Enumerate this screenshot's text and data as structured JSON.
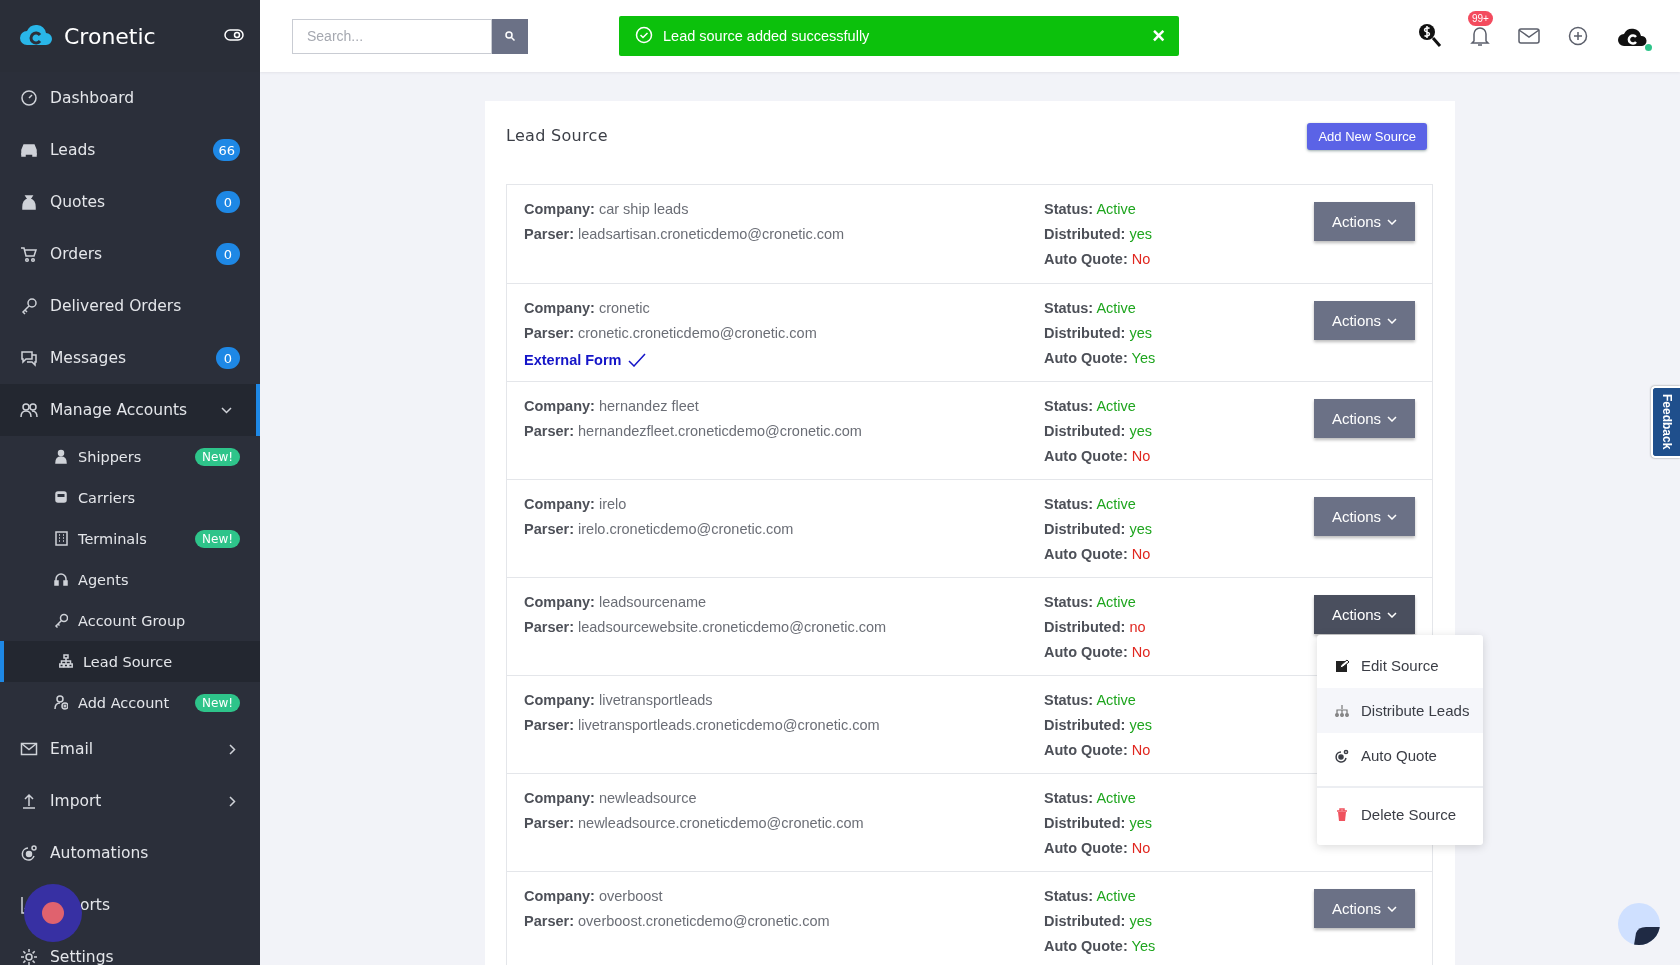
{
  "brand": {
    "name": "Cronetic"
  },
  "sidebar": {
    "items": [
      {
        "kind": "item",
        "label": "Dashboard",
        "selected": false
      },
      {
        "kind": "item",
        "label": "Leads",
        "badge": {
          "text": "66",
          "kind": "count"
        },
        "selected": false
      },
      {
        "kind": "item",
        "label": "Quotes",
        "badge": {
          "text": "0",
          "kind": "count"
        },
        "selected": false
      },
      {
        "kind": "item",
        "label": "Orders",
        "badge": {
          "text": "0",
          "kind": "count"
        },
        "selected": false
      },
      {
        "kind": "item",
        "label": "Delivered Orders",
        "selected": false
      },
      {
        "kind": "item",
        "label": "Messages",
        "badge": {
          "text": "0",
          "kind": "count"
        },
        "selected": false
      },
      {
        "kind": "group",
        "label": "Manage Accounts",
        "expanded": true,
        "selected": false,
        "children": [
          {
            "label": "Shippers",
            "badge": {
              "text": "New!",
              "kind": "new"
            },
            "selected": false
          },
          {
            "label": "Carriers",
            "selected": false
          },
          {
            "label": "Terminals",
            "badge": {
              "text": "New!",
              "kind": "new"
            },
            "selected": false
          },
          {
            "label": "Agents",
            "selected": false
          },
          {
            "label": "Account Group",
            "selected": false
          },
          {
            "label": "Lead Source",
            "selected": true
          },
          {
            "label": "Add Account",
            "badge": {
              "text": "New!",
              "kind": "new"
            },
            "selected": false
          }
        ]
      },
      {
        "kind": "group",
        "label": "Email",
        "expanded": false,
        "selected": false
      },
      {
        "kind": "group",
        "label": "Import",
        "expanded": false,
        "selected": false
      },
      {
        "kind": "item",
        "label": "Automations",
        "selected": false
      },
      {
        "kind": "item",
        "label": "orts",
        "obscured": true,
        "selected": false
      },
      {
        "kind": "item",
        "label": "Settings",
        "selected": false
      }
    ]
  },
  "topbar": {
    "search": {
      "placeholder": "Search..."
    },
    "toast": {
      "message": "Lead source added successfully",
      "close": "×"
    },
    "notifications_badge": "99+"
  },
  "card": {
    "title": "Lead Source",
    "add_button": "Add New Source",
    "rows": [
      {
        "left": [
          {
            "label": "Company:",
            "value": "car ship leads"
          },
          {
            "label": "Parser:",
            "value": "leadsartisan.croneticdemo@cronetic.com"
          }
        ],
        "right": [
          {
            "label": "Status:",
            "value": "Active",
            "positive": true
          },
          {
            "label": "Distributed:",
            "value": "yes",
            "positive": true
          },
          {
            "label": "Auto Quote:",
            "value": "No",
            "positive": false
          }
        ],
        "actions": {
          "label": "Actions",
          "open": false
        }
      },
      {
        "left": [
          {
            "label": "Company:",
            "value": "cronetic"
          },
          {
            "label": "Parser:",
            "value": "cronetic.croneticdemo@cronetic.com"
          }
        ],
        "external_form": "External Form",
        "right": [
          {
            "label": "Status:",
            "value": "Active",
            "positive": true
          },
          {
            "label": "Distributed:",
            "value": "yes",
            "positive": true
          },
          {
            "label": "Auto Quote:",
            "value": "Yes",
            "positive": true
          }
        ],
        "actions": {
          "label": "Actions",
          "open": false
        }
      },
      {
        "left": [
          {
            "label": "Company:",
            "value": "hernandez fleet"
          },
          {
            "label": "Parser:",
            "value": "hernandezfleet.croneticdemo@cronetic.com"
          }
        ],
        "right": [
          {
            "label": "Status:",
            "value": "Active",
            "positive": true
          },
          {
            "label": "Distributed:",
            "value": "yes",
            "positive": true
          },
          {
            "label": "Auto Quote:",
            "value": "No",
            "positive": false
          }
        ],
        "actions": {
          "label": "Actions",
          "open": false
        }
      },
      {
        "left": [
          {
            "label": "Company:",
            "value": "irelo"
          },
          {
            "label": "Parser:",
            "value": "irelo.croneticdemo@cronetic.com"
          }
        ],
        "right": [
          {
            "label": "Status:",
            "value": "Active",
            "positive": true
          },
          {
            "label": "Distributed:",
            "value": "yes",
            "positive": true
          },
          {
            "label": "Auto Quote:",
            "value": "No",
            "positive": false
          }
        ],
        "actions": {
          "label": "Actions",
          "open": false
        }
      },
      {
        "left": [
          {
            "label": "Company:",
            "value": "leadsourcename"
          },
          {
            "label": "Parser:",
            "value": "leadsourcewebsite.croneticdemo@cronetic.com"
          }
        ],
        "right": [
          {
            "label": "Status:",
            "value": "Active",
            "positive": true
          },
          {
            "label": "Distributed:",
            "value": "no",
            "positive": false
          },
          {
            "label": "Auto Quote:",
            "value": "No",
            "positive": false
          }
        ],
        "actions": {
          "label": "Actions",
          "open": true,
          "menu": [
            {
              "kind": "edit",
              "label": "Edit Source",
              "selected": false
            },
            {
              "kind": "distribute",
              "label": "Distribute Leads",
              "selected": true
            },
            {
              "kind": "auto",
              "label": "Auto Quote",
              "selected": false
            },
            {
              "kind": "delete",
              "label": "Delete Source",
              "selected": false
            }
          ]
        }
      },
      {
        "left": [
          {
            "label": "Company:",
            "value": "livetransportleads"
          },
          {
            "label": "Parser:",
            "value": "livetransportleads.croneticdemo@cronetic.com"
          }
        ],
        "right": [
          {
            "label": "Status:",
            "value": "Active",
            "positive": true
          },
          {
            "label": "Distributed:",
            "value": "yes",
            "positive": true
          },
          {
            "label": "Auto Quote:",
            "value": "No",
            "positive": false
          }
        ]
      },
      {
        "left": [
          {
            "label": "Company:",
            "value": "newleadsource"
          },
          {
            "label": "Parser:",
            "value": "newleadsource.croneticdemo@cronetic.com"
          }
        ],
        "right": [
          {
            "label": "Status:",
            "value": "Active",
            "positive": true
          },
          {
            "label": "Distributed:",
            "value": "yes",
            "positive": true
          },
          {
            "label": "Auto Quote:",
            "value": "No",
            "positive": false
          }
        ]
      },
      {
        "left": [
          {
            "label": "Company:",
            "value": "overboost"
          },
          {
            "label": "Parser:",
            "value": "overboost.croneticdemo@cronetic.com"
          }
        ],
        "right": [
          {
            "label": "Status:",
            "value": "Active",
            "positive": true
          },
          {
            "label": "Distributed:",
            "value": "yes",
            "positive": true
          },
          {
            "label": "Auto Quote:",
            "value": "Yes",
            "positive": true
          }
        ],
        "actions": {
          "label": "Actions",
          "open": false
        }
      }
    ]
  },
  "feedback_tab": {
    "label": "Feedback"
  }
}
